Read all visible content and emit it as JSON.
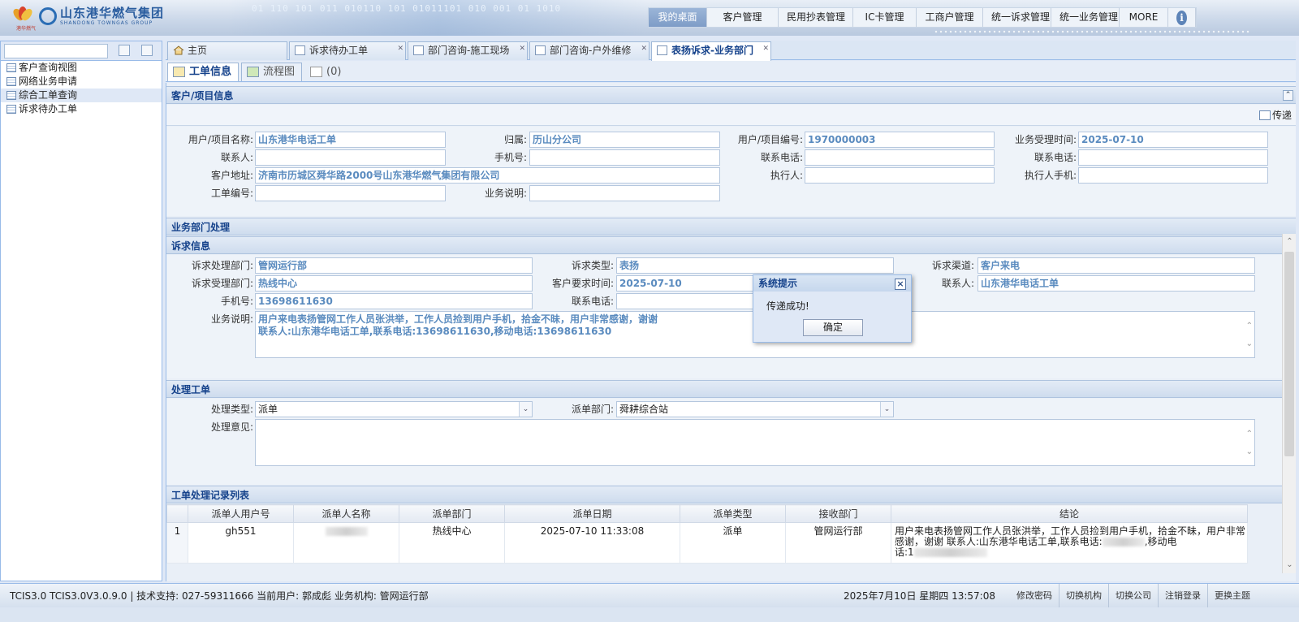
{
  "header": {
    "logo_cn": "山东港华燃气集团",
    "logo_en": "SHANDONG TOWNGAS GROUP",
    "logo_sub": "港华燃气",
    "bits": "01 110 101 011 010110 101 01011101 010 001 01 1010",
    "nav": [
      {
        "label": "我的桌面",
        "active": true
      },
      {
        "label": "客户管理"
      },
      {
        "label": "民用抄表管理"
      },
      {
        "label": "IC卡管理"
      },
      {
        "label": "工商户管理"
      },
      {
        "label": "统一诉求管理"
      },
      {
        "label": "统一业务管理"
      },
      {
        "label": "MORE"
      }
    ],
    "info_glyph": "i"
  },
  "left": {
    "search_value": "",
    "tree": [
      {
        "label": "客户查询视图"
      },
      {
        "label": "网络业务申请"
      },
      {
        "label": "综合工单查询",
        "selected": true
      },
      {
        "label": "诉求待办工单"
      }
    ]
  },
  "tabs": [
    {
      "label": "主页"
    },
    {
      "label": "诉求待办工单"
    },
    {
      "label": "部门咨询-施工现场"
    },
    {
      "label": "部门咨询-户外维修"
    },
    {
      "label": "表扬诉求-业务部门"
    }
  ],
  "subtabs": [
    {
      "label": "工单信息"
    },
    {
      "label": "流程图"
    },
    {
      "label": "(0)"
    }
  ],
  "customer": {
    "title": "客户/项目信息",
    "forward_label": "传递",
    "fields": {
      "name": {
        "label": "用户/项目名称:",
        "value": "山东港华电话工单"
      },
      "belong": {
        "label": "归属:",
        "value": "历山分公司"
      },
      "code": {
        "label": "用户/项目编号:",
        "value": "1970000003"
      },
      "accept_time": {
        "label": "业务受理时间:",
        "value": "2025-07-10"
      },
      "contact": {
        "label": "联系人:",
        "value": ""
      },
      "mobile": {
        "label": "手机号:",
        "value": ""
      },
      "phone": {
        "label": "联系电话:",
        "value": ""
      },
      "phone2": {
        "label": "联系电话:",
        "value": ""
      },
      "address": {
        "label": "客户地址:",
        "value": "济南市历城区舜华路2000号山东港华燃气集团有限公司"
      },
      "executor": {
        "label": "执行人:",
        "value": ""
      },
      "executor_mobile": {
        "label": "执行人手机:",
        "value": ""
      },
      "order_no": {
        "label": "工单编号:",
        "value": ""
      },
      "biz_desc": {
        "label": "业务说明:",
        "value": ""
      }
    }
  },
  "dept": {
    "title": "业务部门处理",
    "appeal_title": "诉求信息",
    "fields": {
      "handle_dept": {
        "label": "诉求处理部门:",
        "value": "管网运行部"
      },
      "appeal_type": {
        "label": "诉求类型:",
        "value": "表扬"
      },
      "channel": {
        "label": "诉求渠道:",
        "value": "客户来电"
      },
      "accept_dept": {
        "label": "诉求受理部门:",
        "value": "热线中心"
      },
      "req_time": {
        "label": "客户要求时间:",
        "value": "2025-07-10"
      },
      "contact": {
        "label": "联系人:",
        "value": "山东港华电话工单"
      },
      "mobile": {
        "label": "手机号:",
        "value": "13698611630"
      },
      "phone": {
        "label": "联系电话:",
        "value": ""
      },
      "desc": {
        "label": "业务说明:",
        "line1": "用户来电表扬管网工作人员张洪举，工作人员捡到用户手机，拾金不昧，用户非常感谢，谢谢",
        "line2": "联系人:山东港华电话工单,联系电话:13698611630,移动电话:13698611630"
      }
    }
  },
  "process": {
    "title": "处理工单",
    "type_label": "处理类型:",
    "type_value": "派单",
    "dept_label": "派单部门:",
    "dept_value": "舜耕综合站",
    "opinion_label": "处理意见:"
  },
  "records": {
    "title": "工单处理记录列表",
    "columns": [
      "",
      "派单人用户号",
      "派单人名称",
      "派单部门",
      "派单日期",
      "派单类型",
      "接收部门",
      "结论"
    ],
    "rows": [
      {
        "no": "1",
        "user_id": "gh551",
        "dept": "热线中心",
        "date": "2025-07-10 11:33:08",
        "type": "派单",
        "recv": "管网运行部",
        "c1": "用户来电表扬管网工作人员张洪举，工作人员捡到用户手机，拾金不昧，用户非常",
        "c2a": "感谢，谢谢 联系人:山东港华电话工单,联系电话:",
        "c2b": ",移动电",
        "c3": "话:1"
      }
    ]
  },
  "dialog": {
    "title": "系统提示",
    "close": "×",
    "message": "传递成功!",
    "ok": "确定"
  },
  "footer": {
    "left": "TCIS3.0 TCIS3.0V3.0.9.0 | 技术支持: 027-59311666  当前用户: 郭成彪  业务机构: 管网运行部",
    "date": "2025年7月10日 星期四 13:57:08",
    "links": [
      "修改密码",
      "切换机构",
      "切换公司",
      "注销登录",
      "更换主题"
    ]
  }
}
